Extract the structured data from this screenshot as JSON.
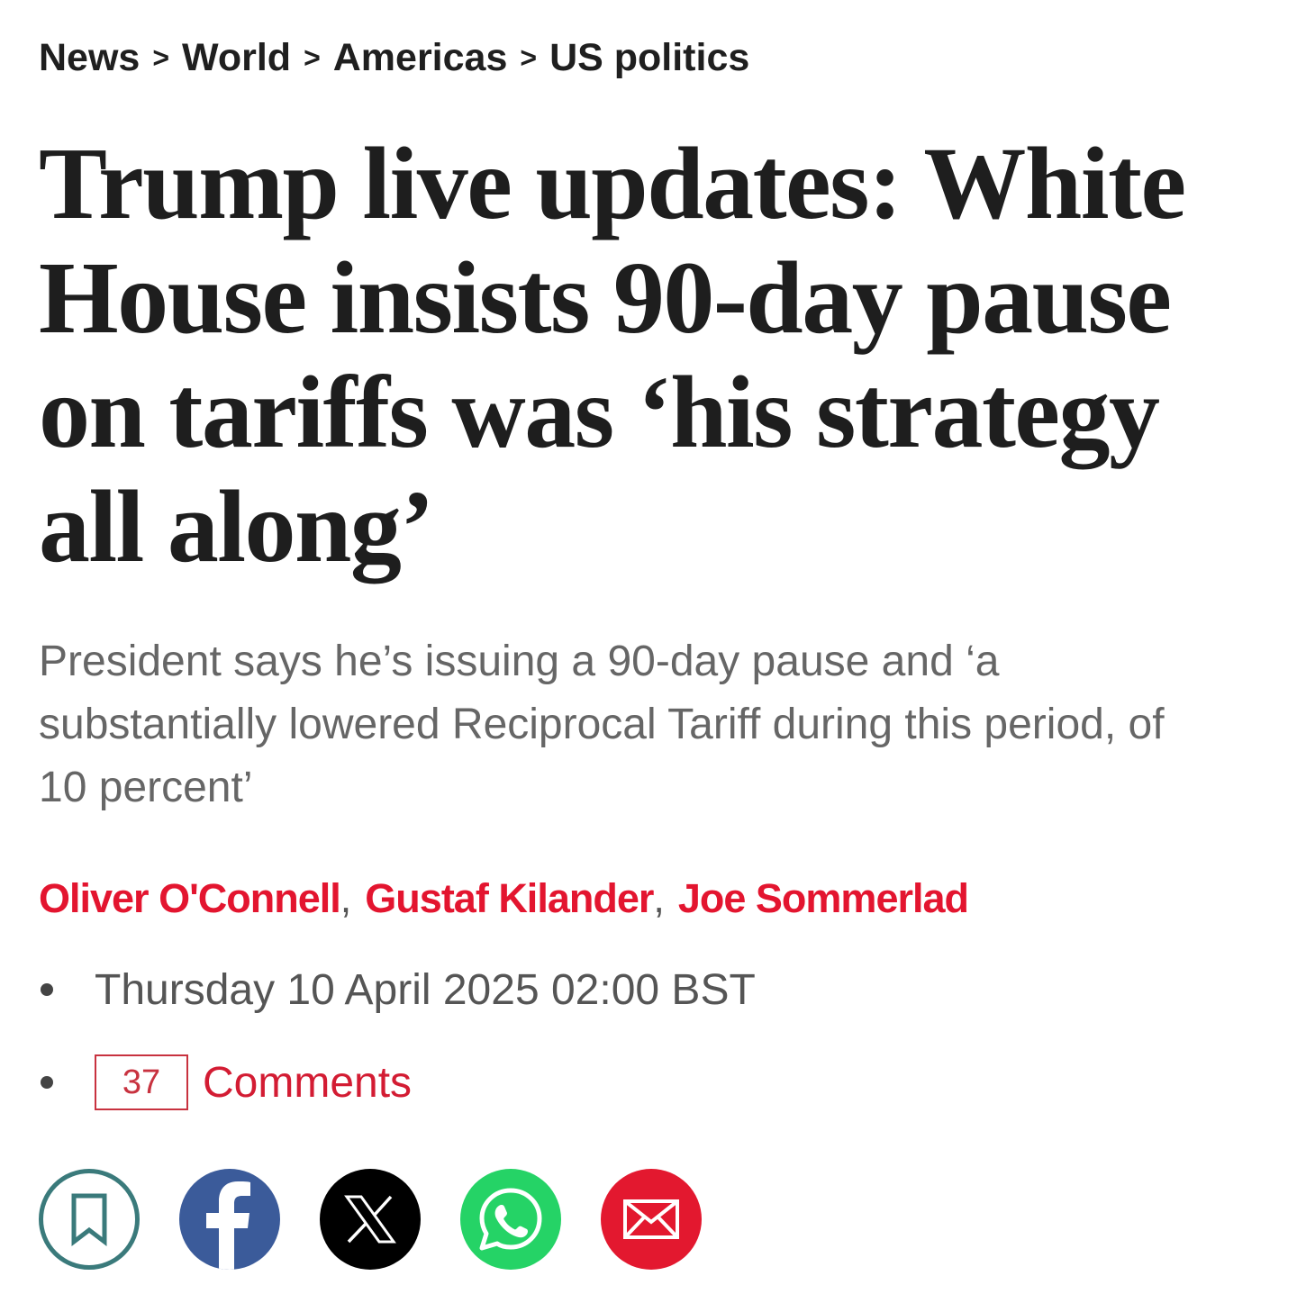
{
  "breadcrumb": {
    "items": [
      "News",
      "World",
      "Americas",
      "US politics"
    ],
    "separator": ">"
  },
  "article": {
    "headline": "Trump live updates: White House insists 90-day pause on tariffs was ‘his strategy all along’",
    "standfirst": "President says he’s issuing a 90-day pause and ‘a substantially lowered Reciprocal Tariff during this period, of 10 percent’",
    "authors": [
      "Oliver O'Connell",
      "Gustaf Kilander",
      "Joe Sommerlad"
    ],
    "author_separator": ",",
    "date": "Thursday 10 April 2025 02:00 BST",
    "comments": {
      "count": "37",
      "label": "Comments"
    }
  },
  "share": {
    "buttons": [
      {
        "name": "bookmark",
        "icon": "bookmark-icon",
        "color": "#3a7a7b"
      },
      {
        "name": "facebook",
        "icon": "facebook-icon",
        "color": "#3b5b9a"
      },
      {
        "name": "x",
        "icon": "x-icon",
        "color": "#000000"
      },
      {
        "name": "whatsapp",
        "icon": "whatsapp-icon",
        "color": "#25d366"
      },
      {
        "name": "email",
        "icon": "email-icon",
        "color": "#e3182f"
      }
    ]
  },
  "colors": {
    "accent": "#e3152f",
    "text": "#1e1e1e",
    "muted": "#666666"
  }
}
